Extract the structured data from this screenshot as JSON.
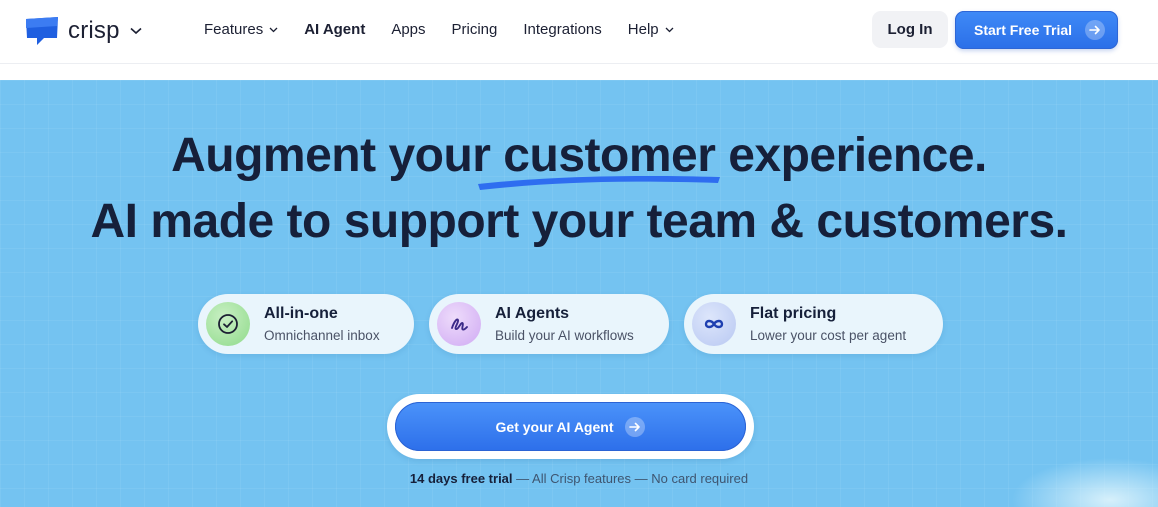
{
  "header": {
    "brand": "crisp",
    "nav": [
      {
        "label": "Features",
        "has_dropdown": true,
        "active": false
      },
      {
        "label": "AI Agent",
        "has_dropdown": false,
        "active": true
      },
      {
        "label": "Apps",
        "has_dropdown": false,
        "active": false
      },
      {
        "label": "Pricing",
        "has_dropdown": false,
        "active": false
      },
      {
        "label": "Integrations",
        "has_dropdown": false,
        "active": false
      },
      {
        "label": "Help",
        "has_dropdown": true,
        "active": false
      }
    ],
    "login_label": "Log In",
    "trial_label": "Start Free Trial"
  },
  "hero": {
    "headline_1_before": "Augment your ",
    "headline_1_highlight": "customer",
    "headline_1_after": " experience.",
    "headline_2": "AI made to support your team & customers.",
    "features": [
      {
        "title": "All-in-one",
        "subtitle": "Omnichannel inbox",
        "icon": "check-circle-icon"
      },
      {
        "title": "AI Agents",
        "subtitle": "Build your AI workflows",
        "icon": "scribble-icon"
      },
      {
        "title": "Flat pricing",
        "subtitle": "Lower your cost per agent",
        "icon": "infinity-icon"
      }
    ],
    "cta_label": "Get your AI Agent",
    "trial_note_bold": "14 days free trial",
    "trial_note_rest": " — All Crisp features — No card required"
  },
  "colors": {
    "accent": "#2d6fea",
    "hero_bg": "#74c3f1",
    "text_dark": "#16203a"
  }
}
